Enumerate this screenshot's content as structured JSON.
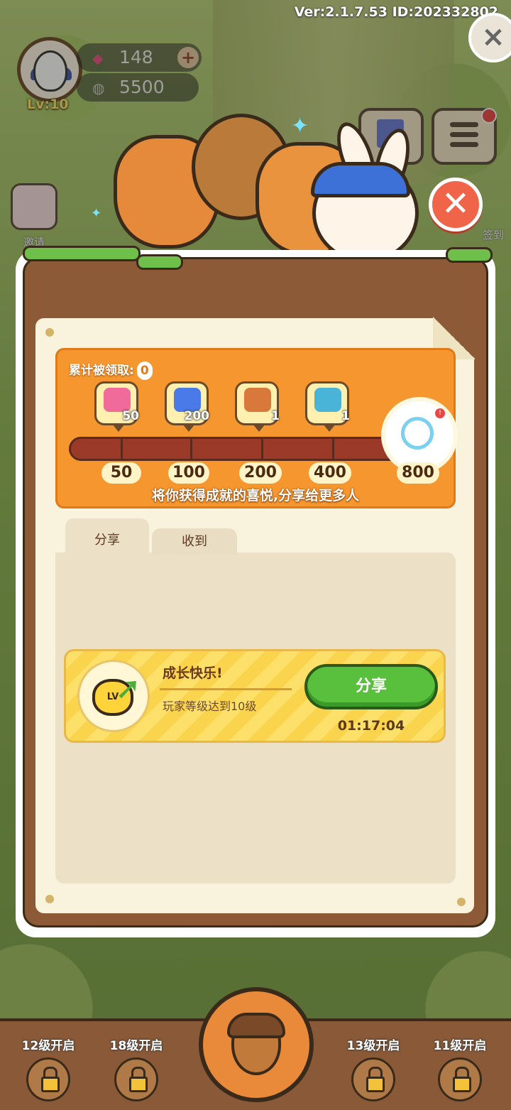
{
  "header": {
    "version": "Ver:2.1.7.53 ID:202332802",
    "level": "Lv:10",
    "gems": "148",
    "coins": "5500",
    "invite_label": "邀请",
    "right_side_label": "签到"
  },
  "progress": {
    "claimed_label": "累计被领取:",
    "claimed_count": "0",
    "rewards": [
      {
        "icon": "gem-icon",
        "value": "50"
      },
      {
        "icon": "energy-icon",
        "value": "200"
      },
      {
        "icon": "wooden-chest-icon",
        "value": "1"
      },
      {
        "icon": "blue-chest-icon",
        "value": "1"
      }
    ],
    "milestones": [
      "50",
      "100",
      "200",
      "400",
      "800"
    ],
    "progress_fraction": 0,
    "slogan": "将你获得成就的喜悦,分享给更多人"
  },
  "tabs": {
    "share": "分享",
    "received": "收到"
  },
  "task": {
    "title": "成长快乐!",
    "description": "玩家等级达到10级",
    "button": "分享",
    "timer": "01:17:04",
    "icon_text": "LV"
  },
  "bottom": {
    "slots": [
      "12级开启",
      "18级开启",
      "13级开启",
      "11级开启"
    ]
  },
  "colors": {
    "panel_brown": "#8d5a38",
    "progress_orange": "#f5962e",
    "share_green": "#59c03e",
    "close_red": "#f0654a"
  }
}
